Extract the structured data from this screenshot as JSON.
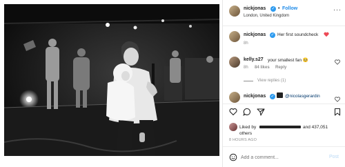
{
  "header": {
    "username": "nickjonas",
    "follow_label": "Follow",
    "location": "London, United Kingdom"
  },
  "caption": {
    "username": "nickjonas",
    "text": "Her first soundcheck",
    "time": "8h"
  },
  "comments": [
    {
      "username": "kelly.s27",
      "text": "your smallest fan 🥺",
      "time": "8h",
      "likes": "84 likes",
      "reply_label": "Reply",
      "view_replies": "View replies (1)"
    },
    {
      "username": "nickjonas",
      "mention": "@nicolasgerardin"
    }
  ],
  "likes": {
    "prefix": "Liked by",
    "and_text": "and 437,051",
    "others": "others",
    "time": "8 HOURS AGO"
  },
  "comment_box": {
    "placeholder": "Add a comment...",
    "post_label": "Post"
  },
  "colors": {
    "follow": "#1d8ae8",
    "verified": "#2d9bf0",
    "heart": "#ed4956"
  }
}
